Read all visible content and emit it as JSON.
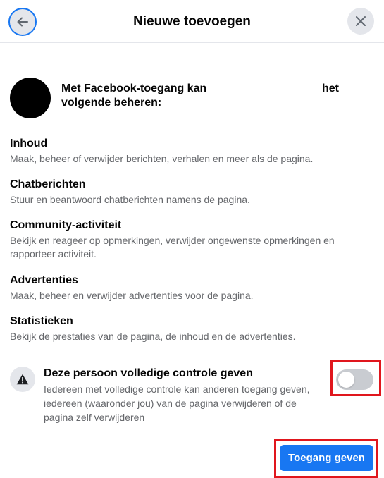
{
  "header": {
    "title": "Nieuwe toevoegen"
  },
  "intro": {
    "line1_start": "Met Facebook-toegang kan",
    "line1_end": "het",
    "line2": "volgende beheren:"
  },
  "permissions": [
    {
      "title": "Inhoud",
      "description": "Maak, beheer of verwijder berichten, verhalen en meer als de pagina."
    },
    {
      "title": "Chatberichten",
      "description": "Stuur en beantwoord chatberichten namens de pagina."
    },
    {
      "title": "Community-activiteit",
      "description": "Bekijk en reageer op opmerkingen, verwijder ongewenste opmerkingen en rapporteer activiteit."
    },
    {
      "title": "Advertenties",
      "description": "Maak, beheer en verwijder advertenties voor de pagina."
    },
    {
      "title": "Statistieken",
      "description": "Bekijk de prestaties van de pagina, de inhoud en de advertenties."
    }
  ],
  "full_control": {
    "title": "Deze persoon volledige controle geven",
    "description": "Iedereen met volledige controle kan anderen toegang geven, iedereen (waaronder jou) van de pagina verwijderen of de pagina zelf verwijderen",
    "enabled": false
  },
  "primary_button": {
    "label": "Toegang geven"
  },
  "colors": {
    "accent": "#1877f2",
    "highlight": "#e0161d",
    "secondary_text": "#65676b"
  },
  "icons": {
    "back": "arrow-left-icon",
    "close": "close-icon",
    "warning": "warning-triangle-icon"
  }
}
